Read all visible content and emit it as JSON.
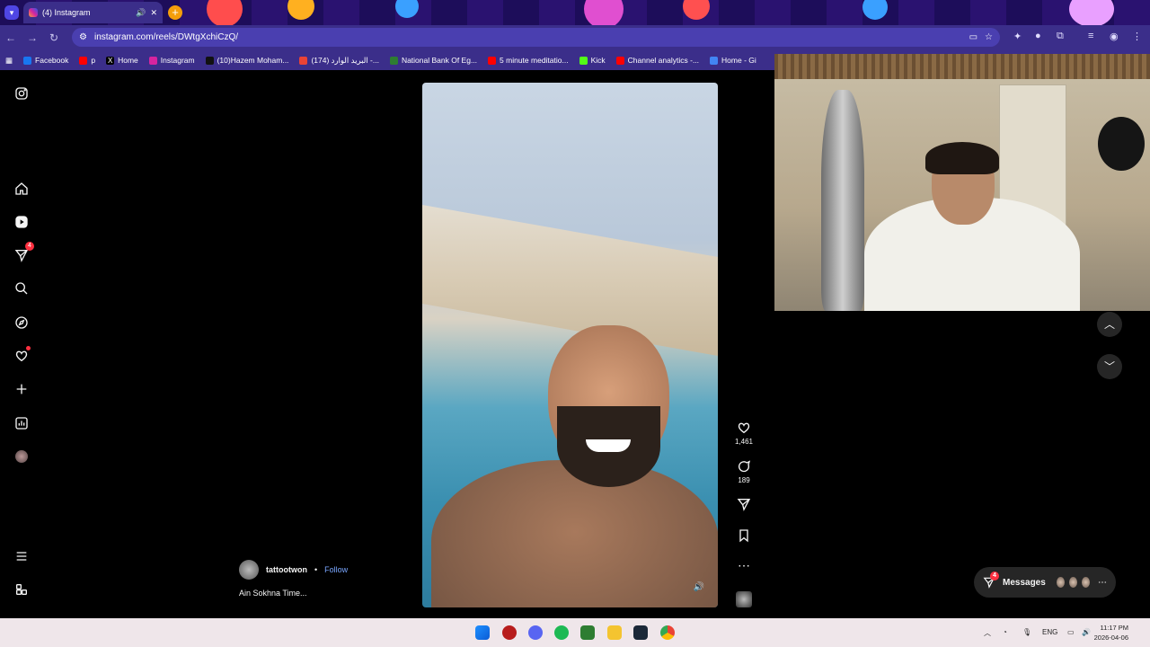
{
  "browser": {
    "tab_title": "(4) Instagram",
    "url": "instagram.com/reels/DWtgXchiCzQ/",
    "bookmarks": [
      {
        "label": "Facebook",
        "color": "#1877f2"
      },
      {
        "label": "p",
        "color": "#ff0000"
      },
      {
        "label": "Home",
        "color": "#000000"
      },
      {
        "label": "Instagram",
        "color": "#d6249f"
      },
      {
        "label": "(10)Hazem Moham...",
        "color": "#111111"
      },
      {
        "label": "(174) البريد الوارد -...",
        "color": "#ea4335"
      },
      {
        "label": "National Bank Of Eg...",
        "color": "#2e7d32"
      },
      {
        "label": "5 minute meditatio...",
        "color": "#ff0000"
      },
      {
        "label": "Kick",
        "color": "#53fc18"
      },
      {
        "label": "Channel analytics -...",
        "color": "#ff0000"
      },
      {
        "label": "Home - Gi",
        "color": "#4285f4"
      }
    ]
  },
  "sidenav": {
    "notifications_badge": "4"
  },
  "reel": {
    "likes": "1,461",
    "comments": "189",
    "username": "tattootwon",
    "separator": "•",
    "follow_label": "Follow",
    "caption": "Ain Sokhna Time..."
  },
  "messages": {
    "label": "Messages",
    "badge": "4"
  },
  "taskbar": {
    "language": "ENG",
    "time": "11:17 PM",
    "date": "2026-04-06"
  },
  "colors": {
    "accent": "#3b2e8a",
    "notification": "#ff3040",
    "follow": "#7aa7ff"
  }
}
